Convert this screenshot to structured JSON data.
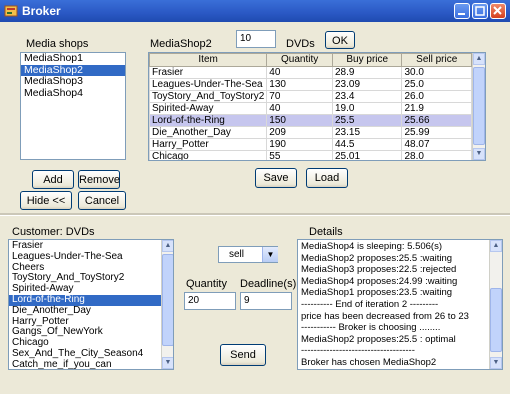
{
  "window": {
    "title": "Broker",
    "colors": {
      "titlebar": "#2a58c4",
      "selection": "#316ac5",
      "row_highlight": "#c6c6ee"
    }
  },
  "media_shops": {
    "label": "Media shops",
    "items": [
      {
        "label": "MediaShop1",
        "selected": false
      },
      {
        "label": "MediaShop2",
        "selected": true
      },
      {
        "label": "MediaShop3",
        "selected": false
      },
      {
        "label": "MediaShop4",
        "selected": false
      }
    ]
  },
  "shop_header": {
    "shop_name": "MediaShop2",
    "count": "10",
    "count_unit": "DVDs",
    "ok_label": "OK"
  },
  "inventory": {
    "columns": [
      "Item",
      "Quantity",
      "Buy price",
      "Sell price"
    ],
    "rows": [
      {
        "cells": [
          "Frasier",
          "40",
          "28.9",
          "30.0"
        ],
        "selected": false
      },
      {
        "cells": [
          "Leagues-Under-The-Sea",
          "130",
          "23.09",
          "25.0"
        ],
        "selected": false
      },
      {
        "cells": [
          "ToyStory_And_ToyStory2",
          "70",
          "23.4",
          "26.0"
        ],
        "selected": false
      },
      {
        "cells": [
          "Spirited-Away",
          "40",
          "19.0",
          "21.9"
        ],
        "selected": false
      },
      {
        "cells": [
          "Lord-of-the-Ring",
          "150",
          "25.5",
          "25.66"
        ],
        "selected": true
      },
      {
        "cells": [
          "Die_Another_Day",
          "209",
          "23.15",
          "25.99"
        ],
        "selected": false
      },
      {
        "cells": [
          "Harry_Potter",
          "190",
          "44.5",
          "48.07"
        ],
        "selected": false
      },
      {
        "cells": [
          "Chicago",
          "55",
          "25.01",
          "28.0"
        ],
        "selected": false
      }
    ]
  },
  "shop_actions": {
    "add": "Add",
    "remove": "Remove",
    "hide": "Hide <<",
    "cancel": "Cancel",
    "save": "Save",
    "load": "Load"
  },
  "customer": {
    "label": "Customer: DVDs",
    "items": [
      {
        "label": "Frasier",
        "selected": false
      },
      {
        "label": "Leagues-Under-The-Sea",
        "selected": false
      },
      {
        "label": "Cheers",
        "selected": false
      },
      {
        "label": "ToyStory_And_ToyStory2",
        "selected": false
      },
      {
        "label": "Spirited-Away",
        "selected": false
      },
      {
        "label": "Lord-of-the-Ring",
        "selected": true
      },
      {
        "label": "Die_Another_Day",
        "selected": false
      },
      {
        "label": "Harry_Potter",
        "selected": false
      },
      {
        "label": "Gangs_Of_NewYork",
        "selected": false
      },
      {
        "label": "Chicago",
        "selected": false
      },
      {
        "label": "Sex_And_The_City_Season4",
        "selected": false
      },
      {
        "label": "Catch_me_if_you_can",
        "selected": false
      }
    ]
  },
  "order": {
    "mode": "sell",
    "quantity_label": "Quantity",
    "quantity_value": "20",
    "deadline_label": "Deadline(s)",
    "deadline_value": "9",
    "send_label": "Send"
  },
  "details": {
    "label": "Details",
    "lines": [
      "MediaShop4 is sleeping: 5.506(s)",
      "MediaShop2 proposes:25.5 :waiting",
      "MediaShop3 proposes:22.5 :rejected",
      "MediaShop4 proposes:24.99 :waiting",
      "MediaShop1 proposes:23.5 :waiting",
      "---------- End of iteration 2 ---------",
      " price has been decreased from 26 to 23",
      "----------- Broker is choosing ........",
      "MediaShop2 proposes:25.5 : optimal",
      "------------------------------------",
      "Broker has chosen MediaShop2"
    ]
  }
}
